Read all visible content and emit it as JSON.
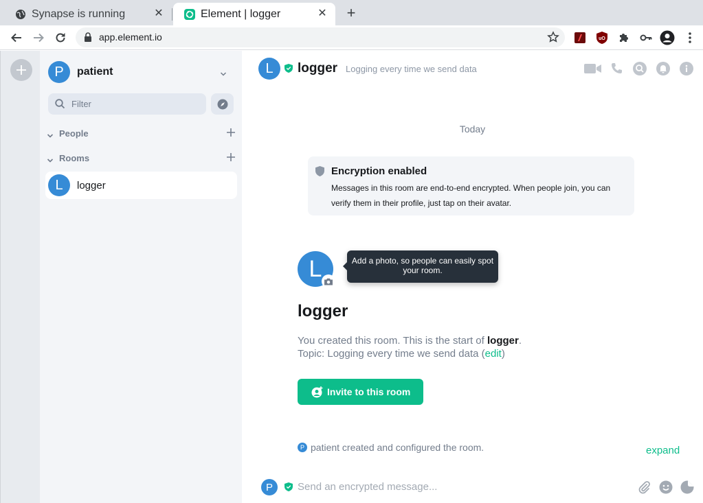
{
  "browser": {
    "tabs": [
      {
        "title": "Synapse is running",
        "icon": "globe-icon"
      },
      {
        "title": "Element | logger",
        "icon": "element-logo-icon",
        "active": true
      }
    ],
    "url": "app.element.io"
  },
  "leftpanel": {
    "user_initial": "P",
    "user_name": "patient",
    "filter_placeholder": "Filter",
    "sections": [
      {
        "label": "People"
      },
      {
        "label": "Rooms"
      }
    ],
    "rooms": [
      {
        "initial": "L",
        "name": "logger"
      }
    ]
  },
  "room": {
    "initial": "L",
    "name": "logger",
    "topic": "Logging every time we send data",
    "date_separator": "Today",
    "encryption": {
      "title": "Encryption enabled",
      "body": "Messages in this room are end-to-end encrypted. When people join, you can verify them in their profile, just tap on their avatar."
    },
    "tooltip": "Add a photo, so people can easily spot your room.",
    "intro": {
      "created_prefix": "You created this room. This is the start of ",
      "created_room": "logger",
      "created_suffix": ".",
      "topic_prefix": "Topic: Logging every time we send data (",
      "topic_edit": "edit",
      "topic_suffix": ")"
    },
    "invite_label": "Invite to this room",
    "summary_initial": "P",
    "summary_text": "patient created and configured the room.",
    "expand_label": "expand",
    "composer_initial": "P",
    "composer_placeholder": "Send an encrypted message..."
  },
  "colors": {
    "accent": "#0dbd8b",
    "avatar": "#368bd6",
    "tooltip_bg": "#27303a"
  }
}
